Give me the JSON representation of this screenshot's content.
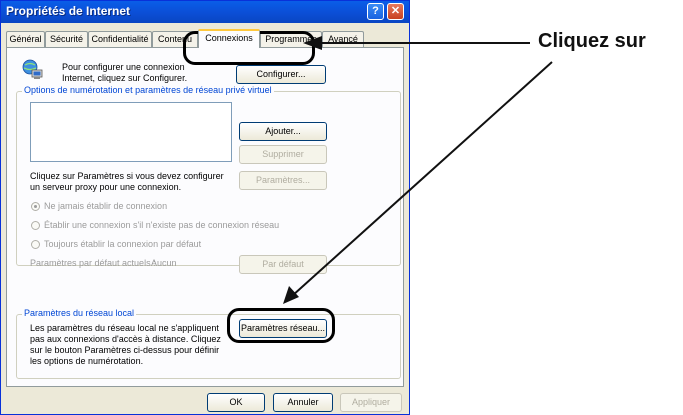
{
  "window": {
    "title": "Propriétés de Internet",
    "help_glyph": "?",
    "close_glyph": "✕"
  },
  "tabs": [
    {
      "label": "Général",
      "active": false
    },
    {
      "label": "Sécurité",
      "active": false
    },
    {
      "label": "Confidentialité",
      "active": false
    },
    {
      "label": "Contenu",
      "active": false
    },
    {
      "label": "Connexions",
      "active": true
    },
    {
      "label": "Programmes",
      "active": false
    },
    {
      "label": "Avancé",
      "active": false
    }
  ],
  "setup": {
    "text": "Pour configurer une connexion Internet, cliquez sur Configurer.",
    "button": "Configurer..."
  },
  "dialup": {
    "legend": "Options de numérotation et paramètres de réseau privé virtuel",
    "add_button": "Ajouter...",
    "remove_button": "Supprimer",
    "proxy_text": "Cliquez sur Paramètres si vous devez configurer un serveur proxy pour une connexion.",
    "settings_button": "Paramètres...",
    "radios": [
      {
        "label": "Ne jamais établir de connexion",
        "checked": true
      },
      {
        "label": "Établir une connexion s'il n'existe pas de connexion réseau",
        "checked": false
      },
      {
        "label": "Toujours établir la connexion par défaut",
        "checked": false
      }
    ],
    "default_label": "Paramètres par défaut actuels :",
    "default_value": "Aucun",
    "default_button": "Par défaut"
  },
  "lan": {
    "legend": "Paramètres du réseau local",
    "text": "Les paramètres du réseau local ne s'appliquent pas aux connexions d'accès à distance. Cliquez sur le bouton Paramètres ci-dessus pour définir les options de numérotation.",
    "button": "Paramètres réseau..."
  },
  "footer": {
    "ok": "OK",
    "cancel": "Annuler",
    "apply": "Appliquer"
  },
  "annotation": {
    "text": "Cliquez sur"
  },
  "colors": {
    "titlebar": "#0a55e0",
    "dialog": "#ece9d8",
    "legend_text": "#0046d5",
    "tab_highlight": "#ffc83c"
  }
}
